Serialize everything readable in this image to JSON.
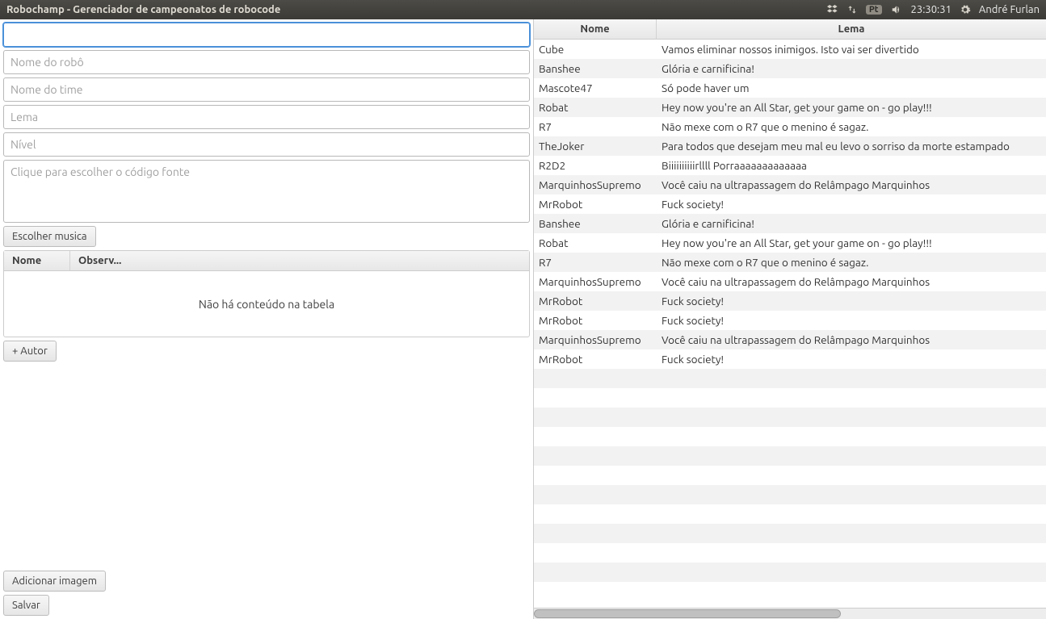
{
  "titlebar": {
    "title": "Robochamp - Gerenciador de campeonatos de robocode"
  },
  "tray": {
    "kbd": "Pt",
    "clock": "23:30:31",
    "user": "André Furlan"
  },
  "form": {
    "field1_value": "",
    "robot_name_placeholder": "Nome do robô",
    "team_name_placeholder": "Nome do time",
    "lema_placeholder": "Lema",
    "nivel_placeholder": "Nível",
    "code_placeholder": "Clique para escolher o código fonte",
    "choose_music_label": "Escolher musica",
    "small_table_headers": {
      "nome": "Nome",
      "obs": "Observ..."
    },
    "empty_table_text": "Não há conteúdo na tabela",
    "add_author_label": "+ Autor",
    "add_image_label": "Adicionar imagem",
    "save_label": "Salvar"
  },
  "robots_table": {
    "headers": {
      "nome": "Nome",
      "lema": "Lema"
    },
    "rows": [
      {
        "nome": "Cube",
        "lema": "Vamos eliminar nossos inimigos. Isto vai ser divertido"
      },
      {
        "nome": "Banshee",
        "lema": "Glória e carnificina!"
      },
      {
        "nome": "Mascote47",
        "lema": "Só pode haver um"
      },
      {
        "nome": "Robat",
        "lema": "Hey now you're an All Star, get your game on - go play!!!"
      },
      {
        "nome": "R7",
        "lema": "Não mexe com o R7 que o menino é sagaz."
      },
      {
        "nome": "TheJoker",
        "lema": "Para todos que desejam meu mal eu levo o sorriso da morte estampado"
      },
      {
        "nome": "R2D2",
        "lema": "Biiiiiiiiiirllll Porraaaaaaaaaaaaa"
      },
      {
        "nome": "MarquinhosSupremo",
        "lema": "Você caiu na ultrapassagem do Relâmpago Marquinhos"
      },
      {
        "nome": "MrRobot",
        "lema": "Fuck society!"
      },
      {
        "nome": "Banshee",
        "lema": "Glória e carnificina!"
      },
      {
        "nome": "Robat",
        "lema": "Hey now you're an All Star, get your game on - go play!!!"
      },
      {
        "nome": "R7",
        "lema": "Não mexe com o R7 que o menino é sagaz."
      },
      {
        "nome": "MarquinhosSupremo",
        "lema": "Você caiu na ultrapassagem do Relâmpago Marquinhos"
      },
      {
        "nome": "MrRobot",
        "lema": "Fuck society!"
      },
      {
        "nome": "MrRobot",
        "lema": "Fuck society!"
      },
      {
        "nome": "MarquinhosSupremo",
        "lema": "Você caiu na ultrapassagem do Relâmpago Marquinhos"
      },
      {
        "nome": "MrRobot",
        "lema": "Fuck society!"
      }
    ],
    "blank_rows": 12
  }
}
